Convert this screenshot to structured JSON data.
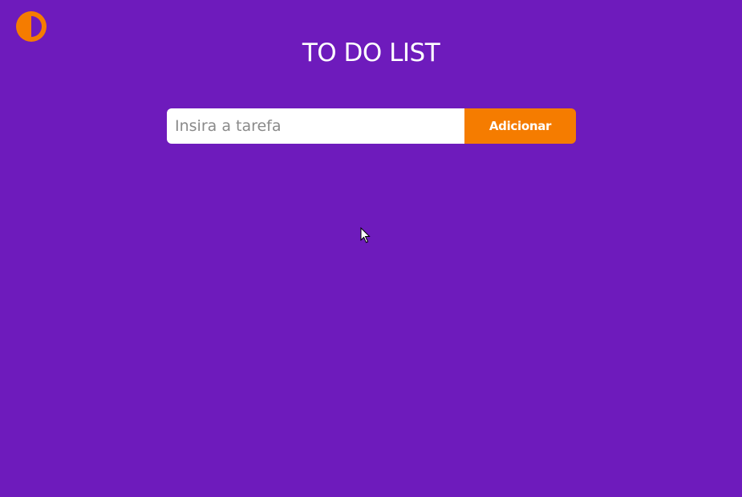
{
  "colors": {
    "background": "#6e1bbc",
    "accent": "#f57c00",
    "text": "#ffffff"
  },
  "theme_toggle": {
    "icon": "half-circle-contrast-icon"
  },
  "header": {
    "title": "TO DO LIST"
  },
  "form": {
    "input_value": "",
    "input_placeholder": "Insira a tarefa",
    "button_label": "Adicionar"
  },
  "tasks": []
}
